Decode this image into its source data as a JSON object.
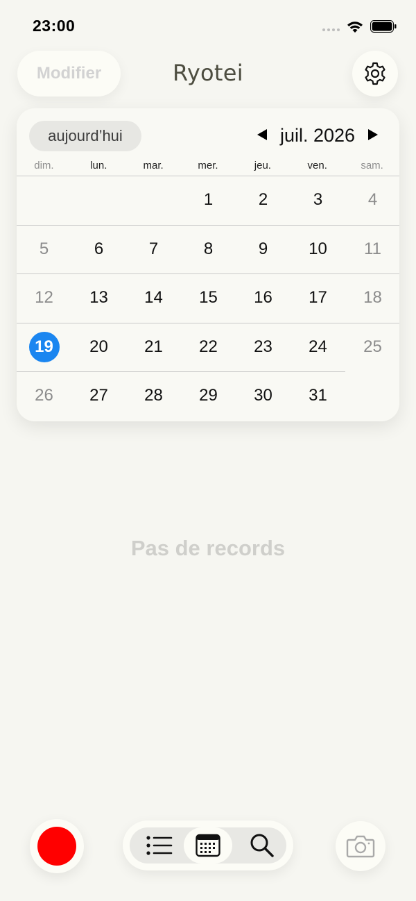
{
  "status": {
    "time": "23:00"
  },
  "header": {
    "edit_label": "Modifier",
    "title": "Ryotei"
  },
  "calendar": {
    "today_label": "aujourd’hui",
    "month_label": "juil. 2026",
    "weekdays": [
      "dim.",
      "lun.",
      "mar.",
      "mer.",
      "jeu.",
      "ven.",
      "sam."
    ],
    "weeks": [
      [
        "",
        "",
        "",
        "1",
        "2",
        "3",
        "4"
      ],
      [
        "5",
        "6",
        "7",
        "8",
        "9",
        "10",
        "11"
      ],
      [
        "12",
        "13",
        "14",
        "15",
        "16",
        "17",
        "18"
      ],
      [
        "19",
        "20",
        "21",
        "22",
        "23",
        "24",
        "25"
      ],
      [
        "26",
        "27",
        "28",
        "29",
        "30",
        "31",
        ""
      ]
    ],
    "selected_day": "19"
  },
  "main": {
    "empty_message": "Pas de records"
  },
  "colors": {
    "accent": "#1b86f0",
    "record": "#ff0000",
    "background": "#f6f6f1"
  },
  "icons": {
    "settings": "gear-icon",
    "record": "record-icon",
    "list": "list-icon",
    "calendar": "calendar-icon",
    "search": "search-icon",
    "camera": "camera-icon"
  }
}
